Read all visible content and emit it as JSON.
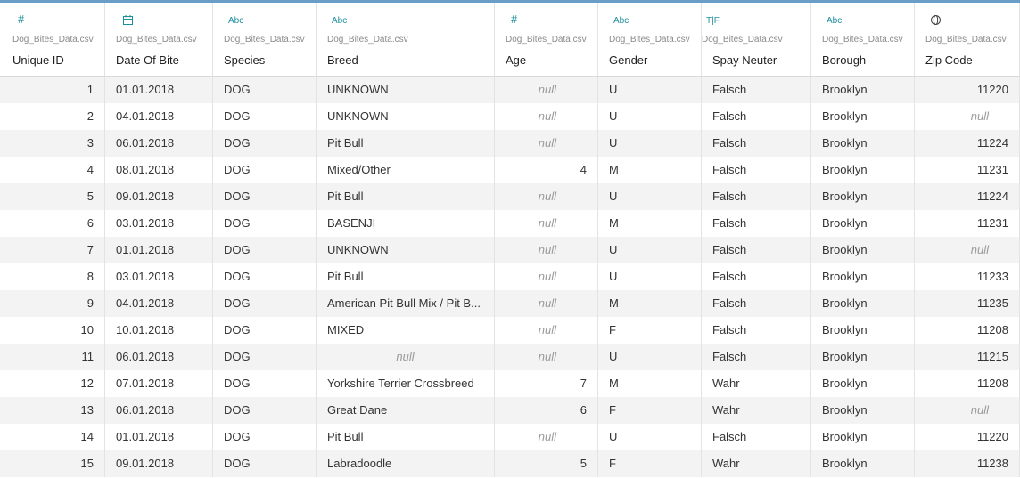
{
  "columns": [
    {
      "key": "id",
      "icon": "number-icon",
      "source": "Dog_Bites_Data.csv",
      "name": "Unique ID",
      "align": "right"
    },
    {
      "key": "date",
      "icon": "calendar-icon",
      "source": "Dog_Bites_Data.csv",
      "name": "Date Of Bite",
      "align": "left"
    },
    {
      "key": "species",
      "icon": "abc-icon",
      "source": "Dog_Bites_Data.csv",
      "name": "Species",
      "align": "left"
    },
    {
      "key": "breed",
      "icon": "abc-icon",
      "source": "Dog_Bites_Data.csv",
      "name": "Breed",
      "align": "left"
    },
    {
      "key": "age",
      "icon": "number-icon",
      "source": "Dog_Bites_Data.csv",
      "name": "Age",
      "align": "right"
    },
    {
      "key": "gender",
      "icon": "abc-icon",
      "source": "Dog_Bites_Data.csv",
      "name": "Gender",
      "align": "left"
    },
    {
      "key": "spay",
      "icon": "boolean-icon",
      "source": "Dog_Bites_Data.csv",
      "name": "Spay Neuter",
      "align": "left"
    },
    {
      "key": "borough",
      "icon": "abc-icon",
      "source": "Dog_Bites_Data.csv",
      "name": "Borough",
      "align": "left"
    },
    {
      "key": "zip",
      "icon": "globe-icon",
      "source": "Dog_Bites_Data.csv",
      "name": "Zip Code",
      "align": "right"
    }
  ],
  "icon_labels": {
    "abc": "Abc",
    "boolean": "T|F",
    "number": "#"
  },
  "null_label": "null",
  "rows": [
    {
      "id": "1",
      "date": "01.01.2018",
      "species": "DOG",
      "breed": "UNKNOWN",
      "age": null,
      "gender": "U",
      "spay": "Falsch",
      "borough": "Brooklyn",
      "zip": "11220"
    },
    {
      "id": "2",
      "date": "04.01.2018",
      "species": "DOG",
      "breed": "UNKNOWN",
      "age": null,
      "gender": "U",
      "spay": "Falsch",
      "borough": "Brooklyn",
      "zip": null
    },
    {
      "id": "3",
      "date": "06.01.2018",
      "species": "DOG",
      "breed": "Pit Bull",
      "age": null,
      "gender": "U",
      "spay": "Falsch",
      "borough": "Brooklyn",
      "zip": "11224"
    },
    {
      "id": "4",
      "date": "08.01.2018",
      "species": "DOG",
      "breed": "Mixed/Other",
      "age": "4",
      "gender": "M",
      "spay": "Falsch",
      "borough": "Brooklyn",
      "zip": "11231"
    },
    {
      "id": "5",
      "date": "09.01.2018",
      "species": "DOG",
      "breed": "Pit Bull",
      "age": null,
      "gender": "U",
      "spay": "Falsch",
      "borough": "Brooklyn",
      "zip": "11224"
    },
    {
      "id": "6",
      "date": "03.01.2018",
      "species": "DOG",
      "breed": "BASENJI",
      "age": null,
      "gender": "M",
      "spay": "Falsch",
      "borough": "Brooklyn",
      "zip": "11231"
    },
    {
      "id": "7",
      "date": "01.01.2018",
      "species": "DOG",
      "breed": "UNKNOWN",
      "age": null,
      "gender": "U",
      "spay": "Falsch",
      "borough": "Brooklyn",
      "zip": null
    },
    {
      "id": "8",
      "date": "03.01.2018",
      "species": "DOG",
      "breed": "Pit Bull",
      "age": null,
      "gender": "U",
      "spay": "Falsch",
      "borough": "Brooklyn",
      "zip": "11233"
    },
    {
      "id": "9",
      "date": "04.01.2018",
      "species": "DOG",
      "breed": "American Pit Bull Mix / Pit B...",
      "age": null,
      "gender": "M",
      "spay": "Falsch",
      "borough": "Brooklyn",
      "zip": "11235"
    },
    {
      "id": "10",
      "date": "10.01.2018",
      "species": "DOG",
      "breed": "MIXED",
      "age": null,
      "gender": "F",
      "spay": "Falsch",
      "borough": "Brooklyn",
      "zip": "11208"
    },
    {
      "id": "11",
      "date": "06.01.2018",
      "species": "DOG",
      "breed": null,
      "age": null,
      "gender": "U",
      "spay": "Falsch",
      "borough": "Brooklyn",
      "zip": "11215"
    },
    {
      "id": "12",
      "date": "07.01.2018",
      "species": "DOG",
      "breed": "Yorkshire Terrier Crossbreed",
      "age": "7",
      "gender": "M",
      "spay": "Wahr",
      "borough": "Brooklyn",
      "zip": "11208"
    },
    {
      "id": "13",
      "date": "06.01.2018",
      "species": "DOG",
      "breed": "Great Dane",
      "age": "6",
      "gender": "F",
      "spay": "Wahr",
      "borough": "Brooklyn",
      "zip": null
    },
    {
      "id": "14",
      "date": "01.01.2018",
      "species": "DOG",
      "breed": "Pit Bull",
      "age": null,
      "gender": "U",
      "spay": "Falsch",
      "borough": "Brooklyn",
      "zip": "11220"
    },
    {
      "id": "15",
      "date": "09.01.2018",
      "species": "DOG",
      "breed": "Labradoodle",
      "age": "5",
      "gender": "F",
      "spay": "Wahr",
      "borough": "Brooklyn",
      "zip": "11238"
    }
  ],
  "colors": {
    "accent_border": "#6a9ec7",
    "icon": "#1f8fa0",
    "row_alt": "#f3f3f3",
    "null_text": "#9a9a9a"
  }
}
